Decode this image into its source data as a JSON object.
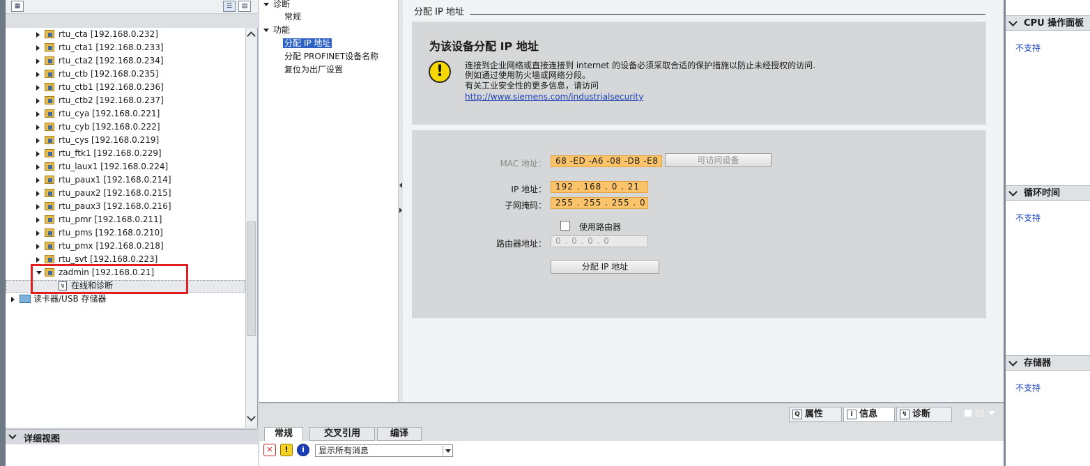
{
  "tree": {
    "items": [
      {
        "label": "rtu_cta [192.168.0.232]"
      },
      {
        "label": "rtu_cta1 [192.168.0.233]"
      },
      {
        "label": "rtu_cta2 [192.168.0.234]"
      },
      {
        "label": "rtu_ctb [192.168.0.235]"
      },
      {
        "label": "rtu_ctb1 [192.168.0.236]"
      },
      {
        "label": "rtu_ctb2 [192.168.0.237]"
      },
      {
        "label": "rtu_cya [192.168.0.221]"
      },
      {
        "label": "rtu_cyb [192.168.0.222]"
      },
      {
        "label": "rtu_cys [192.168.0.219]"
      },
      {
        "label": "rtu_ftk1 [192.168.0.229]"
      },
      {
        "label": "rtu_laux1 [192.168.0.224]"
      },
      {
        "label": "rtu_paux1 [192.168.0.214]"
      },
      {
        "label": "rtu_paux2 [192.168.0.215]"
      },
      {
        "label": "rtu_paux3 [192.168.0.216]"
      },
      {
        "label": "rtu_pmr [192.168.0.211]"
      },
      {
        "label": "rtu_pms [192.168.0.210]"
      },
      {
        "label": "rtu_pmx [192.168.0.218]"
      },
      {
        "label": "rtu_svt [192.168.0.223]"
      }
    ],
    "expanded_item": "zadmin [192.168.0.21]",
    "child_item": "在线和诊断",
    "card_reader": "读卡器/USB 存储器"
  },
  "detail_view": {
    "label": "详细视图"
  },
  "nav": {
    "diag": "诊断",
    "general": "常规",
    "function": "功能",
    "assign_ip": "分配 IP 地址",
    "assign_profinet": "分配 PROFINET设备名称",
    "factory_reset": "复位为出厂设置"
  },
  "main": {
    "section_title": "分配 IP 地址",
    "warn_title": "为该设备分配 IP 地址",
    "warn_line1": "连接到企业网络或直接连接到 internet 的设备必须采取合适的保护措施以防止未经授权的访问.",
    "warn_line2": "例如通过使用防火墙或网络分段。",
    "warn_line3": "有关工业安全性的更多信息，请访问",
    "warn_link": "http://www.siemens.com/industrialsecurity",
    "mac_label": "MAC 地址：",
    "mac_value": "68 -ED -A6 -08 -DB -E8",
    "accessible_devices": "可访问设备",
    "ip_label": "IP 地址：",
    "ip_value": "192 . 168 . 0   . 21",
    "subnet_label": "子网掩码：",
    "subnet_value": "255 . 255 . 255 . 0",
    "use_router": "使用路由器",
    "router_label": "路由器地址：",
    "router_value": "0   . 0   . 0   . 0",
    "assign_button": "分配 IP 地址"
  },
  "right": {
    "cpu_panel": "CPU 操作面板",
    "cpu_status": "不支持",
    "cycle_time": "循环时间",
    "cycle_status": "不支持",
    "memory": "存储器",
    "memory_status": "不支持"
  },
  "inspector": {
    "tab_properties": "属性",
    "tab_info": "信息",
    "tab_diag": "诊断",
    "sub_general": "常规",
    "sub_xref": "交叉引用",
    "sub_compile": "编译",
    "filter": "显示所有消息"
  }
}
